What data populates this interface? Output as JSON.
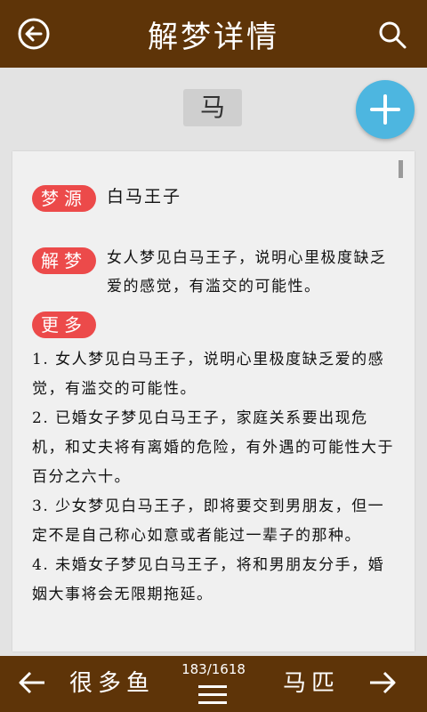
{
  "header": {
    "title": "解梦详情",
    "back_icon": "back-arrow-circle-icon",
    "search_icon": "search-icon"
  },
  "keyword": "马",
  "add_icon": "plus-icon",
  "sections": {
    "source": {
      "tag": "梦源",
      "text": "白马王子"
    },
    "interpretation": {
      "tag": "解梦",
      "text": "女人梦见白马王子，说明心里极度缺乏爱的感觉，有滥交的可能性。"
    },
    "more": {
      "tag": "更多",
      "items": [
        "1. 女人梦见白马王子，说明心里极度缺乏爱的感觉，有滥交的可能性。",
        "2. 已婚女子梦见白马王子，家庭关系要出现危机，和丈夫将有离婚的危险，有外遇的可能性大于百分之六十。",
        "3. 少女梦见白马王子，即将要交到男朋友，但一定不是自己称心如意或者能过一辈子的那种。",
        "4. 未婚女子梦见白马王子，将和男朋友分手，婚姻大事将会无限期拖延。"
      ]
    }
  },
  "footer": {
    "prev_label": "很多鱼",
    "next_label": "马匹",
    "counter": "183/1618",
    "prev_icon": "arrow-left-icon",
    "next_icon": "arrow-right-icon",
    "menu_icon": "menu-icon"
  },
  "colors": {
    "bar": "#5e3408",
    "tag": "#ec4a4a",
    "fab": "#4db6e0"
  }
}
